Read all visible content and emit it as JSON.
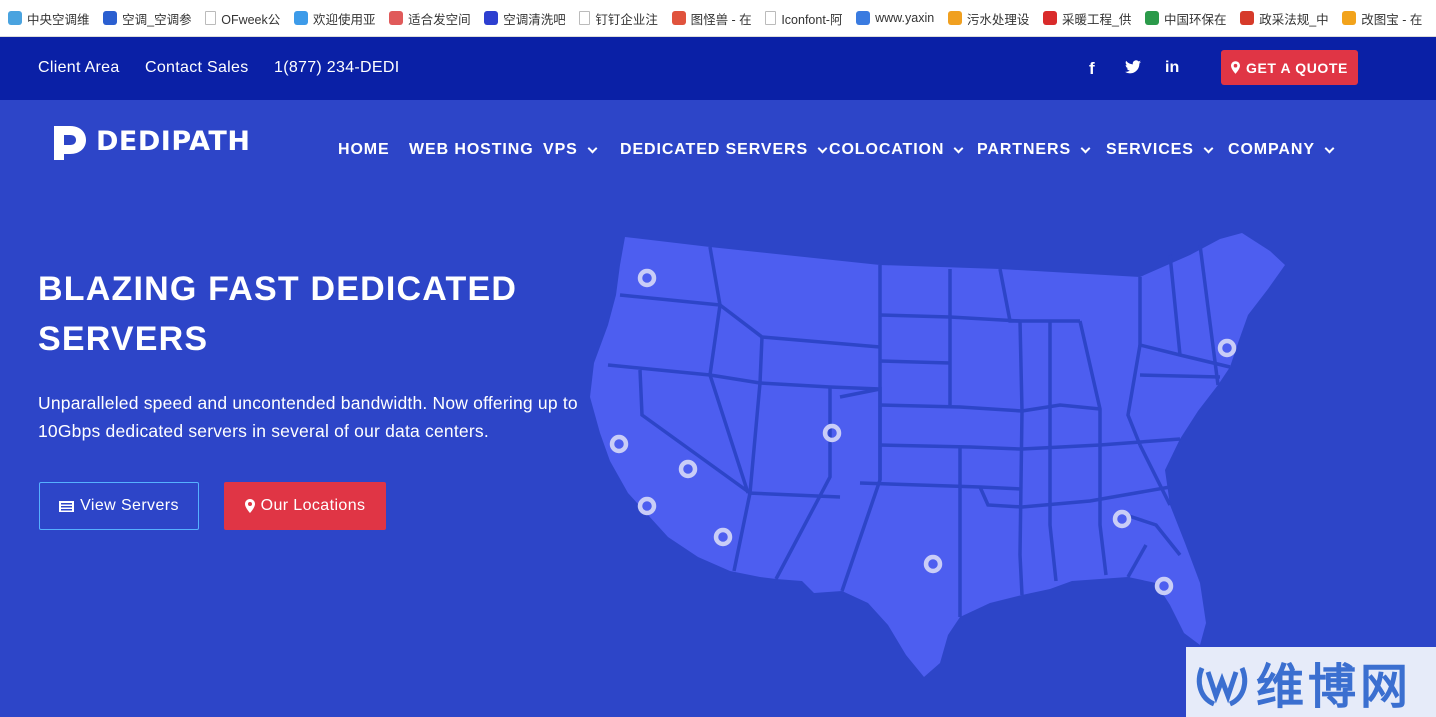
{
  "bookmarks": [
    {
      "label": "中央空调维",
      "icon": "bookmark-icon",
      "color": "#4aa3df"
    },
    {
      "label": "空调_空调参",
      "icon": "bookmark-icon",
      "color": "#2b5fd0"
    },
    {
      "label": "OFweek公",
      "icon": "page-icon",
      "color": "#bbbbbb"
    },
    {
      "label": "欢迎使用亚",
      "icon": "cloud-icon",
      "color": "#3d9be9"
    },
    {
      "label": "适合发空间",
      "icon": "bookmark-icon",
      "color": "#e05a5a"
    },
    {
      "label": "空调清洗吧",
      "icon": "paw-icon",
      "color": "#2d3fd0"
    },
    {
      "label": "钉钉企业注",
      "icon": "page-icon",
      "color": "#bbbbbb"
    },
    {
      "label": "图怪兽 - 在",
      "icon": "bookmark-icon",
      "color": "#e0533d"
    },
    {
      "label": "Iconfont-阿",
      "icon": "page-icon",
      "color": "#bbbbbb"
    },
    {
      "label": "www.yaxin",
      "icon": "bookmark-icon",
      "color": "#3a7be0"
    },
    {
      "label": "污水处理设",
      "icon": "star-icon",
      "color": "#f0a020"
    },
    {
      "label": "采暖工程_供",
      "icon": "flower-icon",
      "color": "#d92b2b"
    },
    {
      "label": "中国环保在",
      "icon": "globe-icon",
      "color": "#2b9a4a"
    },
    {
      "label": "政采法规_中",
      "icon": "emblem-icon",
      "color": "#d63a2a"
    },
    {
      "label": "改图宝 - 在",
      "icon": "bookmark-icon",
      "color": "#f2a31b"
    }
  ],
  "topbar": {
    "client_area": "Client Area",
    "contact_sales": "Contact Sales",
    "phone": "1(877) 234-DEDI",
    "quote_button": "GET A QUOTE",
    "social": [
      {
        "icon": "facebook-icon",
        "label": "f"
      },
      {
        "icon": "twitter-icon",
        "label": "t"
      },
      {
        "icon": "linkedin-icon",
        "label": "in"
      }
    ]
  },
  "header": {
    "logo_text": "DEDIPATH",
    "nav": [
      {
        "label": "HOME",
        "dropdown": false
      },
      {
        "label": "WEB HOSTING",
        "dropdown": false
      },
      {
        "label": "VPS",
        "dropdown": true
      },
      {
        "label": "DEDICATED SERVERS",
        "dropdown": true
      },
      {
        "label": "COLOCATION",
        "dropdown": true
      },
      {
        "label": "PARTNERS",
        "dropdown": true
      },
      {
        "label": "SERVICES",
        "dropdown": true
      },
      {
        "label": "COMPANY",
        "dropdown": true
      }
    ]
  },
  "hero": {
    "title": "BLAZING FAST DEDICATED SERVERS",
    "subtitle": "Unparalleled speed and uncontended bandwidth. Now offering up to 10Gbps dedicated servers in several of our data centers.",
    "view_servers": "View Servers",
    "our_locations": "Our Locations"
  },
  "watermark": {
    "text": "维博网"
  },
  "colors": {
    "topbar": "#0a20a6",
    "hero": "#2d45c8",
    "map": "#4d5ef0",
    "accent_red": "#e03545",
    "outline_blue": "#56b0ff"
  }
}
